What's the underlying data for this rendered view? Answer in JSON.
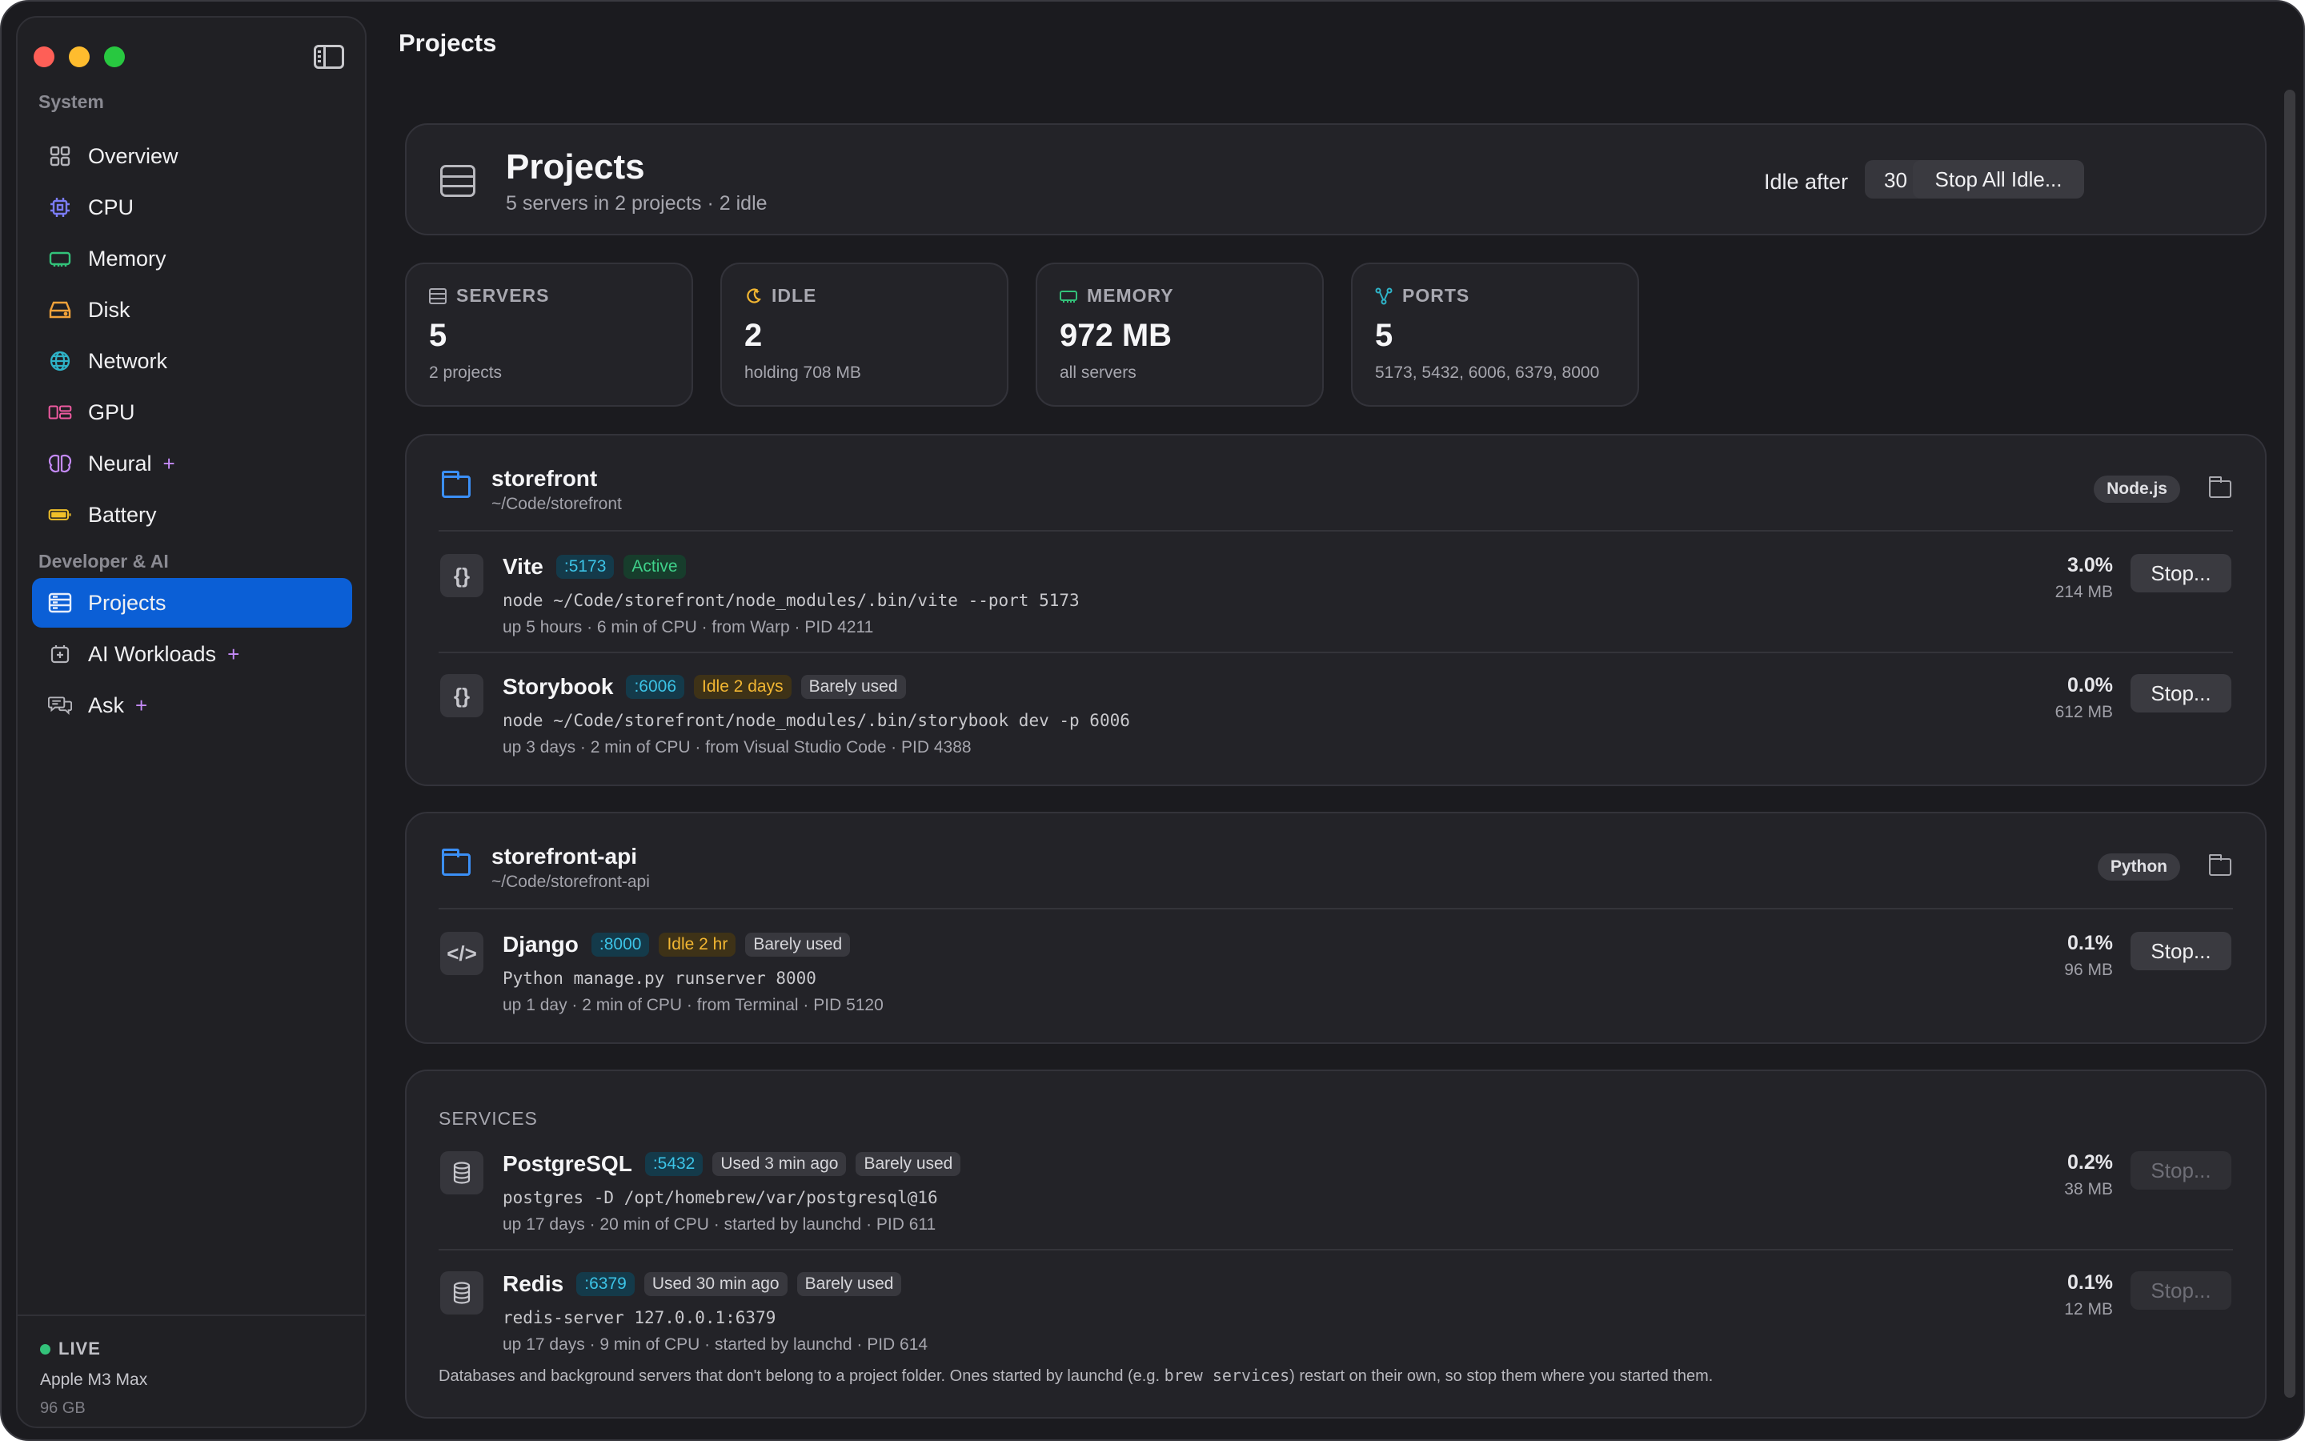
{
  "window": {
    "title": "Projects"
  },
  "sidebar": {
    "sections": [
      {
        "label": "System",
        "items": [
          {
            "label": "Overview",
            "icon": "grid-icon"
          },
          {
            "label": "CPU",
            "icon": "cpu-icon"
          },
          {
            "label": "Memory",
            "icon": "memory-icon"
          },
          {
            "label": "Disk",
            "icon": "disk-icon"
          },
          {
            "label": "Network",
            "icon": "globe-icon"
          },
          {
            "label": "GPU",
            "icon": "gpu-icon"
          },
          {
            "label": "Neural",
            "icon": "brain-icon"
          },
          {
            "label": "Battery",
            "icon": "battery-icon"
          }
        ]
      },
      {
        "label": "Developer & AI",
        "items": [
          {
            "label": "Projects",
            "icon": "server-rack-icon",
            "active": true
          },
          {
            "label": "AI Workloads",
            "icon": "ai-box-icon"
          },
          {
            "label": "Ask",
            "icon": "chat-bubbles-icon"
          }
        ]
      }
    ],
    "sparkle": "+",
    "footer": {
      "status": "LIVE",
      "chip": "Apple M3 Max",
      "ram": "96 GB"
    }
  },
  "header": {
    "title": "Projects",
    "subtitle": "5 servers in 2 projects · 2 idle",
    "idle_label": "Idle after",
    "idle_value": "30 minutes",
    "stop_all": "Stop All Idle..."
  },
  "stats": [
    {
      "label": "SERVERS",
      "value": "5",
      "sub": "2 projects",
      "icon": "server-icon"
    },
    {
      "label": "IDLE",
      "value": "2",
      "sub": "holding 708 MB",
      "icon": "moon-icon"
    },
    {
      "label": "MEMORY",
      "value": "972 MB",
      "sub": "all servers",
      "icon": "memory-icon"
    },
    {
      "label": "PORTS",
      "value": "5",
      "sub": "5173, 5432, 6006, 6379, 8000",
      "icon": "network-nodes-icon"
    }
  ],
  "projects": [
    {
      "name": "storefront",
      "path": "~/Code/storefront",
      "lang": "Node.js",
      "servers": [
        {
          "icon_text": "{}",
          "name": "Vite",
          "port": ":5173",
          "status": "Active",
          "usage": "",
          "cmd": "node ~/Code/storefront/node_modules/.bin/vite --port 5173",
          "meta": "up 5 hours · 6 min of CPU · from Warp · PID 4211",
          "cpu": "3.0%",
          "mem": "214 MB",
          "stop": "Stop..."
        },
        {
          "icon_text": "{}",
          "name": "Storybook",
          "port": ":6006",
          "status": "Idle 2 days",
          "usage": "Barely used",
          "cmd": "node ~/Code/storefront/node_modules/.bin/storybook dev -p 6006",
          "meta": "up 3 days · 2 min of CPU · from Visual Studio Code · PID 4388",
          "cpu": "0.0%",
          "mem": "612 MB",
          "stop": "Stop..."
        }
      ]
    },
    {
      "name": "storefront-api",
      "path": "~/Code/storefront-api",
      "lang": "Python",
      "servers": [
        {
          "icon_text": "</>",
          "name": "Django",
          "port": ":8000",
          "status": "Idle 2 hr",
          "usage": "Barely used",
          "cmd": "Python manage.py runserver 8000",
          "meta": "up 1 day · 2 min of CPU · from Terminal · PID 5120",
          "cpu": "0.1%",
          "mem": "96 MB",
          "stop": "Stop..."
        }
      ]
    }
  ],
  "services": {
    "label": "SERVICES",
    "items": [
      {
        "name": "PostgreSQL",
        "port": ":5432",
        "used": "Used 3 min ago",
        "usage": "Barely used",
        "cmd": "postgres -D /opt/homebrew/var/postgresql@16",
        "meta": "up 17 days · 20 min of CPU · started by launchd · PID 611",
        "cpu": "0.2%",
        "mem": "38 MB",
        "stop": "Stop..."
      },
      {
        "name": "Redis",
        "port": ":6379",
        "used": "Used 30 min ago",
        "usage": "Barely used",
        "cmd": "redis-server 127.0.0.1:6379",
        "meta": "up 17 days · 9 min of CPU · started by launchd · PID 614",
        "cpu": "0.1%",
        "mem": "12 MB",
        "stop": "Stop..."
      }
    ],
    "note_pre": "Databases and background servers that don't belong to a project folder. Ones started by launchd (e.g. ",
    "note_code": "brew services",
    "note_post": ") restart on their own, so stop them where you started them."
  },
  "colors": {
    "accent": "#0b5fd6",
    "port": "#3cc3e6",
    "active": "#3fd18a",
    "idle": "#f2b632"
  }
}
